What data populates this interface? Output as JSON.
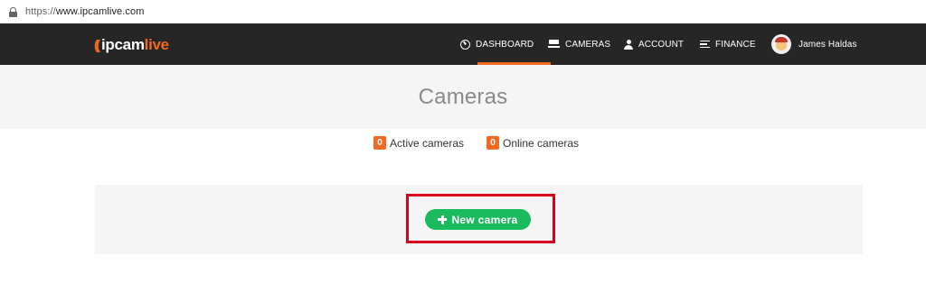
{
  "browser": {
    "url_scheme": "https://",
    "url_host": "www.ipcamlive.com"
  },
  "brand": {
    "logo_prefix": "ipcam",
    "logo_suffix": "live",
    "accent_color": "#f26a21"
  },
  "nav": {
    "dashboard": "DASHBOARD",
    "cameras": "CAMERAS",
    "account": "ACCOUNT",
    "finance": "FINANCE",
    "user_name": "James Haldas"
  },
  "page": {
    "title": "Cameras"
  },
  "stats": {
    "active_count": "0",
    "active_label": "Active cameras",
    "online_count": "0",
    "online_label": "Online cameras"
  },
  "actions": {
    "new_camera_label": "New camera",
    "button_color": "#1aba5f",
    "highlight_color": "#d6001c"
  }
}
